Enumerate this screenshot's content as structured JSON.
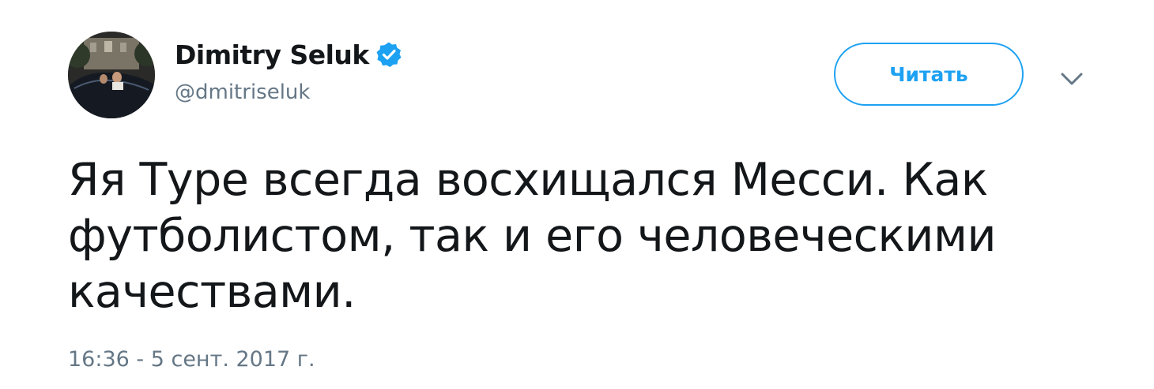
{
  "author": {
    "display_name": "Dimitry Seluk",
    "handle": "@dmitriseluk",
    "verified_icon": "verified-badge-icon",
    "avatar_icon": "profile-photo"
  },
  "actions": {
    "follow_label": "Читать",
    "menu_icon": "chevron-down-icon"
  },
  "tweet": {
    "text_lines": [
      "Яя Туре всегда восхищался Месси. Как",
      "футболистом, так и его человеческими",
      "качествами."
    ],
    "timestamp": "16:36 - 5 сент. 2017 г."
  },
  "colors": {
    "accent": "#1da1f2",
    "text": "#14171a",
    "secondary": "#657786"
  }
}
